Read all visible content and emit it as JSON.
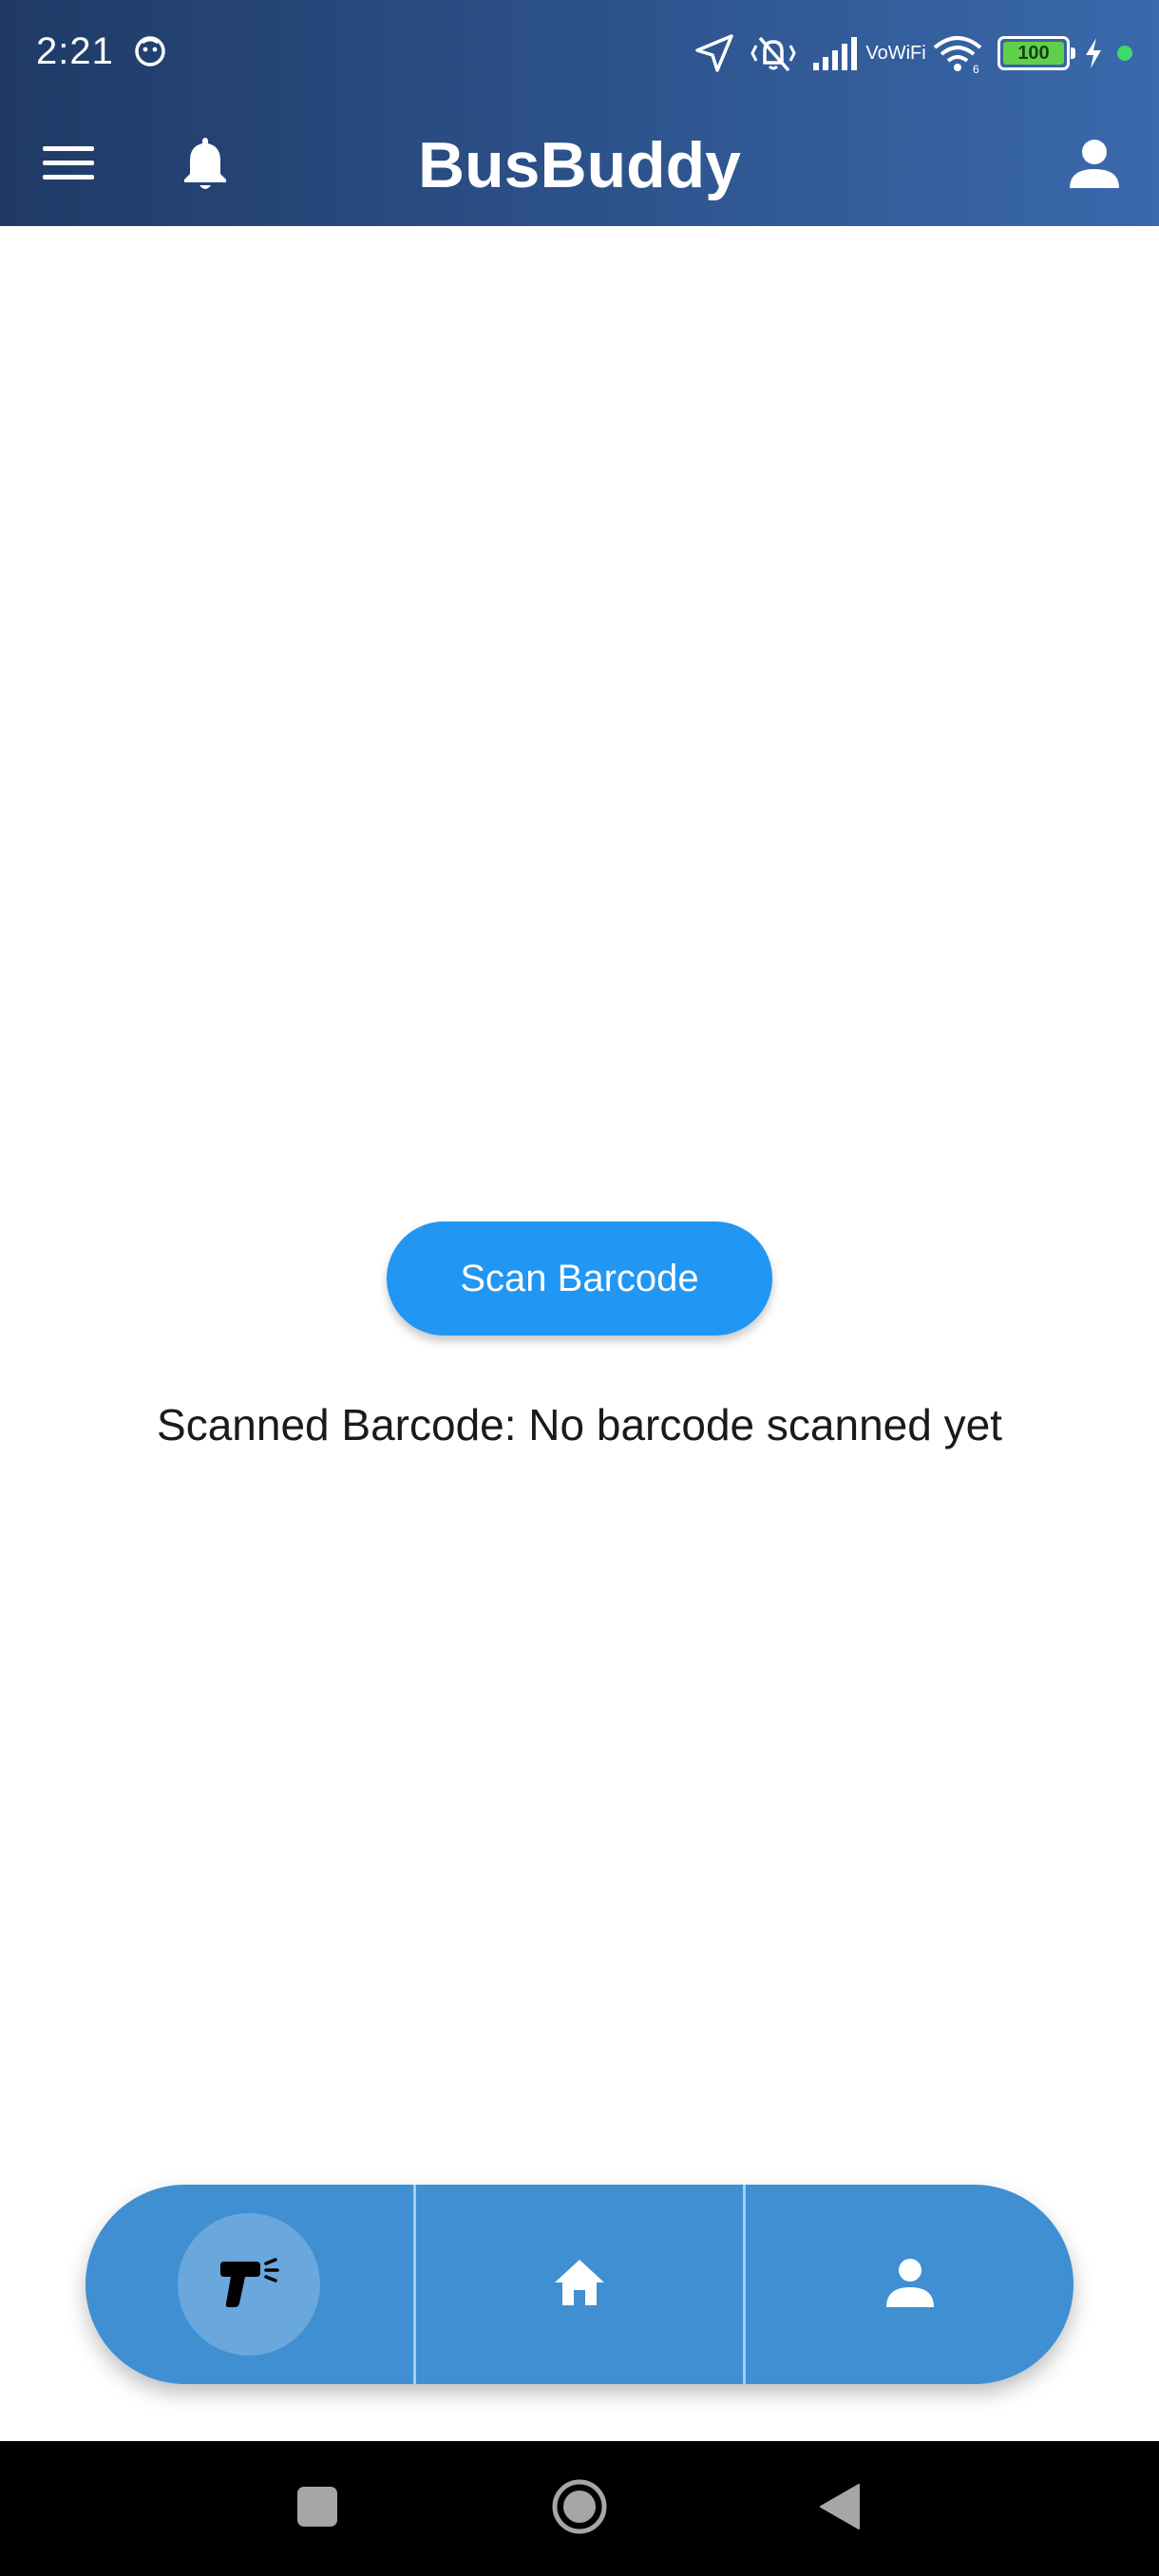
{
  "status_bar": {
    "time": "2:21",
    "vowifi_top": "Vo",
    "vowifi_bottom": "WiFi",
    "battery_level": "100",
    "icons": [
      "sim-status-icon",
      "location-arrow-icon",
      "vibrate-silent-icon",
      "signal-bars-icon",
      "vowifi-icon",
      "wifi-icon",
      "battery-icon",
      "charging-bolt-icon",
      "active-dot-icon"
    ]
  },
  "app_bar": {
    "title": "BusBuddy",
    "left_icons": [
      "menu-icon",
      "bell-icon"
    ],
    "right_icon": "person-icon"
  },
  "main": {
    "scan_button_label": "Scan Barcode",
    "scan_result_text": "Scanned Barcode: No barcode scanned yet"
  },
  "bottom_nav": {
    "items": [
      {
        "icon": "barcode-scanner-icon",
        "active": true
      },
      {
        "icon": "home-icon",
        "active": false
      },
      {
        "icon": "person-icon",
        "active": false
      }
    ]
  },
  "system_nav": {
    "buttons": [
      "recents-icon",
      "home-circle-icon",
      "back-triangle-icon"
    ]
  },
  "colors": {
    "header_start": "#1f3a66",
    "header_end": "#3a69ac",
    "primary_button": "#2196f3",
    "bottom_nav": "#3f8fd2",
    "battery_fill": "#5fd04a"
  }
}
